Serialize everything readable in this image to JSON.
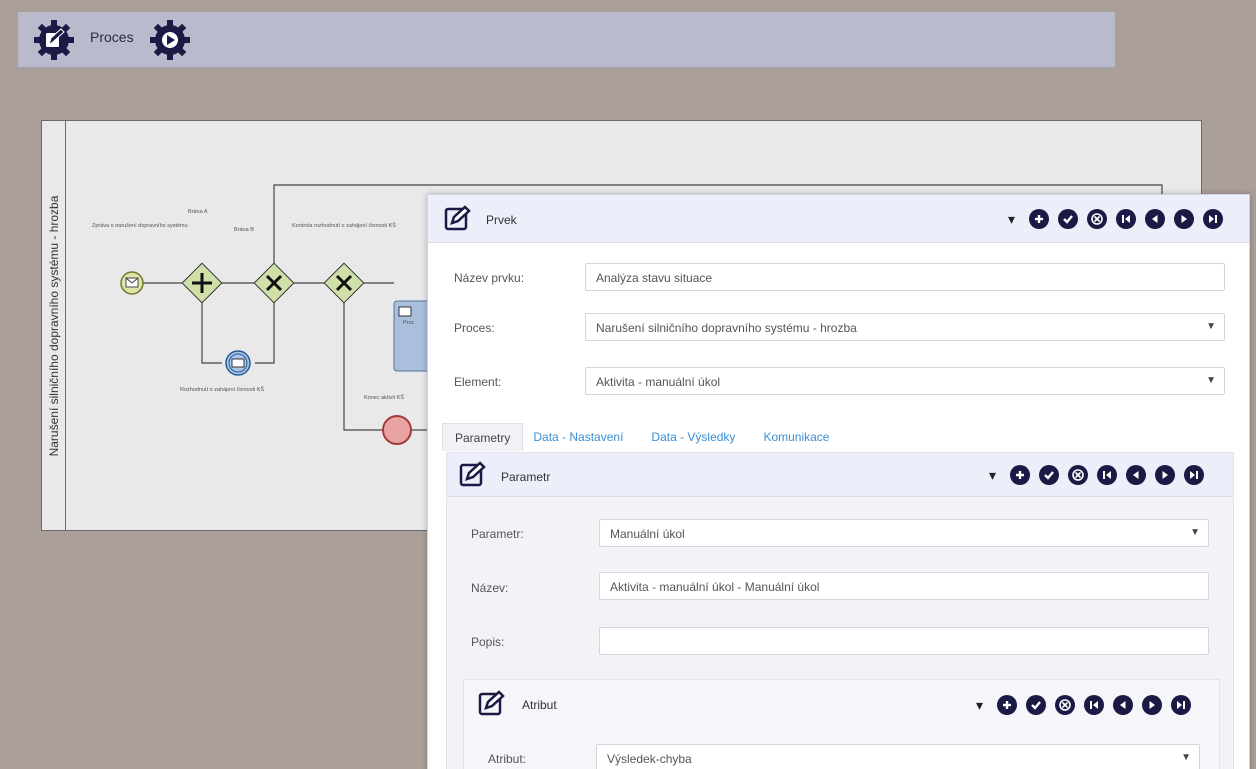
{
  "app": {
    "title": "Proces"
  },
  "pool": {
    "label": "Narušení silničního dopravního systému - hrozba"
  },
  "diagram": {
    "labels": {
      "start_event": "Zpráva o narušení dopravního systému",
      "branch_a": "Brána A",
      "branch_b": "Brána B",
      "check_label": "Kontrola rozhodnutí o zahájení činnosti KŠ",
      "msg_event": "Rozhodnutí o zahájení činnosti KŠ",
      "end_label": "Konec aktivit KŠ"
    },
    "task_label": "Proc"
  },
  "dialog": {
    "header": {
      "title": "Prvek"
    },
    "toolbar": [
      "plus-icon",
      "check-icon",
      "cancel-icon",
      "first-icon",
      "prev-icon",
      "next-icon",
      "last-icon"
    ],
    "fields": {
      "nazev_label": "Název prvku:",
      "nazev_value": "Analýza stavu situace",
      "proces_label": "Proces:",
      "proces_value": "Narušení silničního dopravního systému - hrozba",
      "element_label": "Element:",
      "element_value": "Aktivita - manuální úkol"
    },
    "tabs": [
      "Parametry",
      "Data - Nastavení",
      "Data - Výsledky",
      "Komunikace"
    ],
    "parametr": {
      "header": "Parametr",
      "parametr_label": "Parametr:",
      "parametr_value": "Manuální úkol",
      "nazev_label": "Název:",
      "nazev_value": "Aktivita - manuální úkol - Manuální úkol",
      "popis_label": "Popis:",
      "popis_value": ""
    },
    "atribut": {
      "header": "Atribut",
      "atribut_label": "Atribut:",
      "atribut_value": "Výsledek-chyba"
    }
  },
  "colors": {
    "background": "#ab9f99",
    "topbar": "#b9bbcc",
    "toolbar_button": "#1a1a45",
    "link_tab": "#3a8fd6",
    "gateway_fill": "#cfe0a8"
  }
}
